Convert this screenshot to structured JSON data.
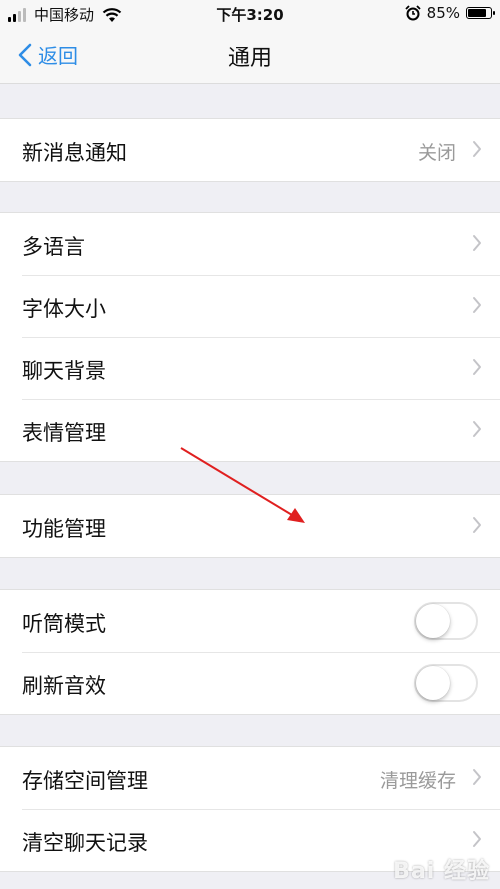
{
  "status_bar": {
    "carrier": "中国移动",
    "time": "下午3:20",
    "battery_text": "85%",
    "battery_level": 0.85
  },
  "nav": {
    "back_label": "返回",
    "title": "通用"
  },
  "sections": [
    {
      "rows": [
        {
          "label": "新消息通知",
          "value": "关闭",
          "type": "chevron"
        }
      ]
    },
    {
      "rows": [
        {
          "label": "多语言",
          "type": "chevron"
        },
        {
          "label": "字体大小",
          "type": "chevron"
        },
        {
          "label": "聊天背景",
          "type": "chevron"
        },
        {
          "label": "表情管理",
          "type": "chevron"
        }
      ]
    },
    {
      "rows": [
        {
          "label": "功能管理",
          "type": "chevron"
        }
      ]
    },
    {
      "rows": [
        {
          "label": "听筒模式",
          "type": "toggle",
          "on": false
        },
        {
          "label": "刷新音效",
          "type": "toggle",
          "on": false
        }
      ]
    },
    {
      "rows": [
        {
          "label": "存储空间管理",
          "value": "清理缓存",
          "type": "chevron"
        },
        {
          "label": "清空聊天记录",
          "type": "chevron"
        }
      ]
    }
  ],
  "watermark": "Bai 经验",
  "colors": {
    "accent": "#2e8de6",
    "annotation": "#e02020"
  }
}
